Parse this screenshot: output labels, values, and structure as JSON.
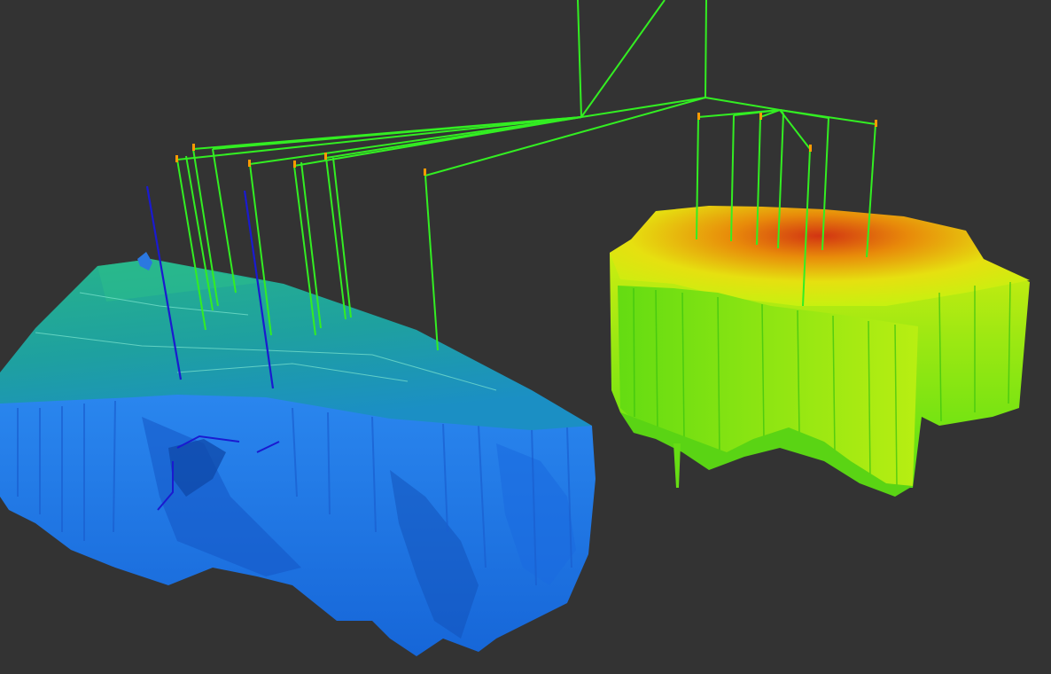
{
  "scene": {
    "background": "#333333",
    "colors": {
      "well_green": "#33ee22",
      "well_blue": "#1a1ad0",
      "well_head_orange": "#ff9a00",
      "left_top_teal": "#1fb08a",
      "left_body_blue": "#1f78e8",
      "right_top_yellow": "#e6ee10",
      "right_peak_red": "#cc2a0a",
      "right_body_green": "#66ee10"
    },
    "left_block": {
      "color_scale": "teal-to-blue",
      "wells_green": 9,
      "wells_blue": 2
    },
    "right_block": {
      "color_scale": "red-to-green",
      "wells_green": 8
    }
  }
}
